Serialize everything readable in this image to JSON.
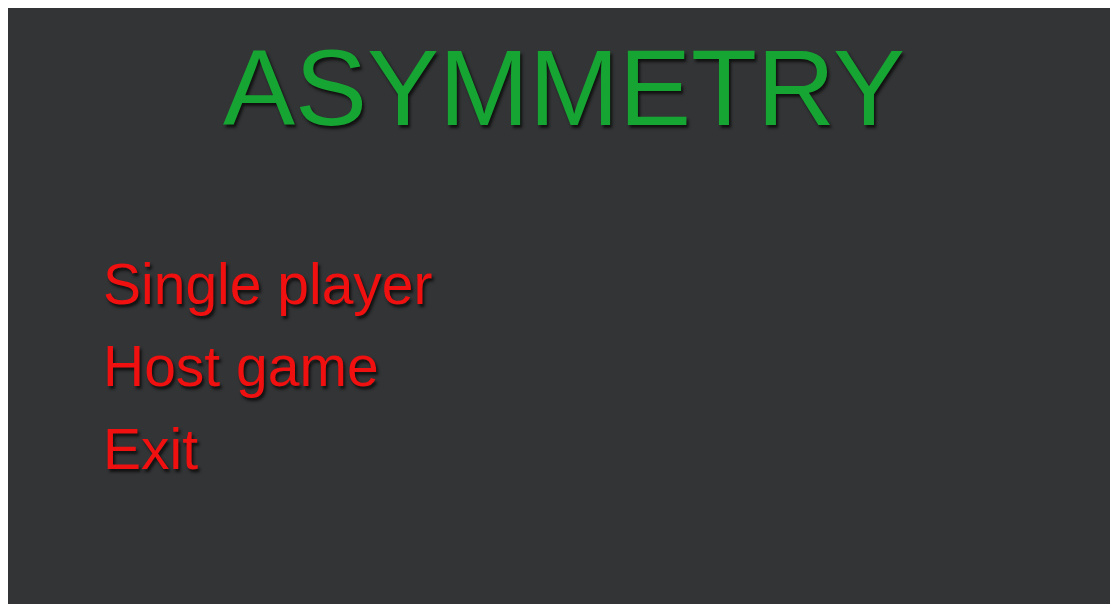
{
  "title": "ASYMMETRY",
  "menu": [
    {
      "label": "Single player"
    },
    {
      "label": "Host game"
    },
    {
      "label": "Exit"
    }
  ]
}
